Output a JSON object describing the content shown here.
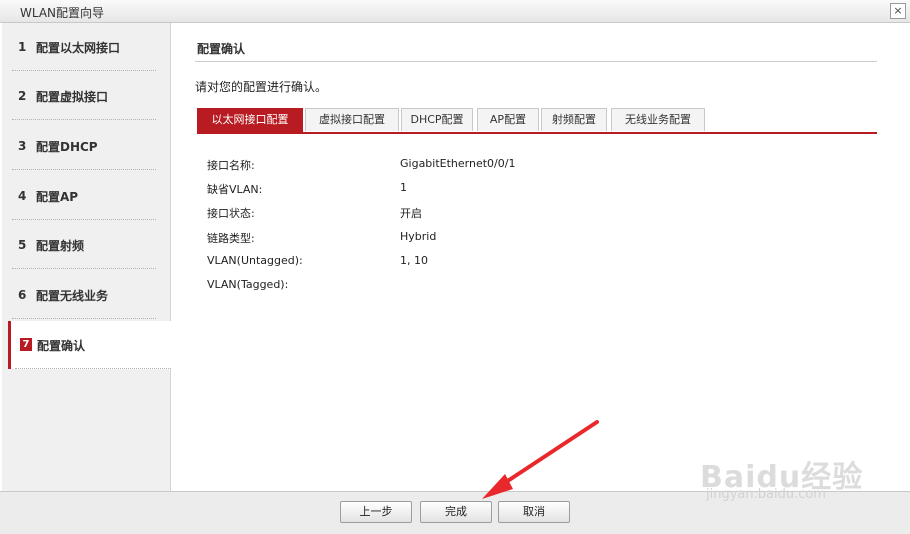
{
  "window": {
    "title": "WLAN配置向导",
    "close_glyph": "×"
  },
  "sidebar": {
    "steps": [
      {
        "num": "1",
        "label": "配置以太网接口"
      },
      {
        "num": "2",
        "label": "配置虚拟接口"
      },
      {
        "num": "3",
        "label": "配置DHCP"
      },
      {
        "num": "4",
        "label": "配置AP"
      },
      {
        "num": "5",
        "label": "配置射频"
      },
      {
        "num": "6",
        "label": "配置无线业务"
      },
      {
        "num": "7",
        "label": "配置确认"
      }
    ]
  },
  "main": {
    "title": "配置确认",
    "instruction": "请对您的配置进行确认。",
    "tabs": [
      {
        "label": "以太网接口配置"
      },
      {
        "label": "虚拟接口配置"
      },
      {
        "label": "DHCP配置"
      },
      {
        "label": "AP配置"
      },
      {
        "label": "射频配置"
      },
      {
        "label": "无线业务配置"
      }
    ],
    "fields": [
      {
        "label": "接口名称:",
        "value": "GigabitEthernet0/0/1"
      },
      {
        "label": "缺省VLAN:",
        "value": "1"
      },
      {
        "label": "接口状态:",
        "value": "开启"
      },
      {
        "label": "链路类型:",
        "value": "Hybrid"
      },
      {
        "label": "VLAN(Untagged):",
        "value": "1, 10"
      },
      {
        "label": "VLAN(Tagged):",
        "value": ""
      }
    ]
  },
  "footer": {
    "prev": "上一步",
    "finish": "完成",
    "cancel": "取消"
  },
  "watermark": {
    "brand": "Baidu经验",
    "url": "jingyan.baidu.com"
  },
  "colors": {
    "accent": "#b81c22",
    "annotation_arrow": "#e8282b"
  }
}
